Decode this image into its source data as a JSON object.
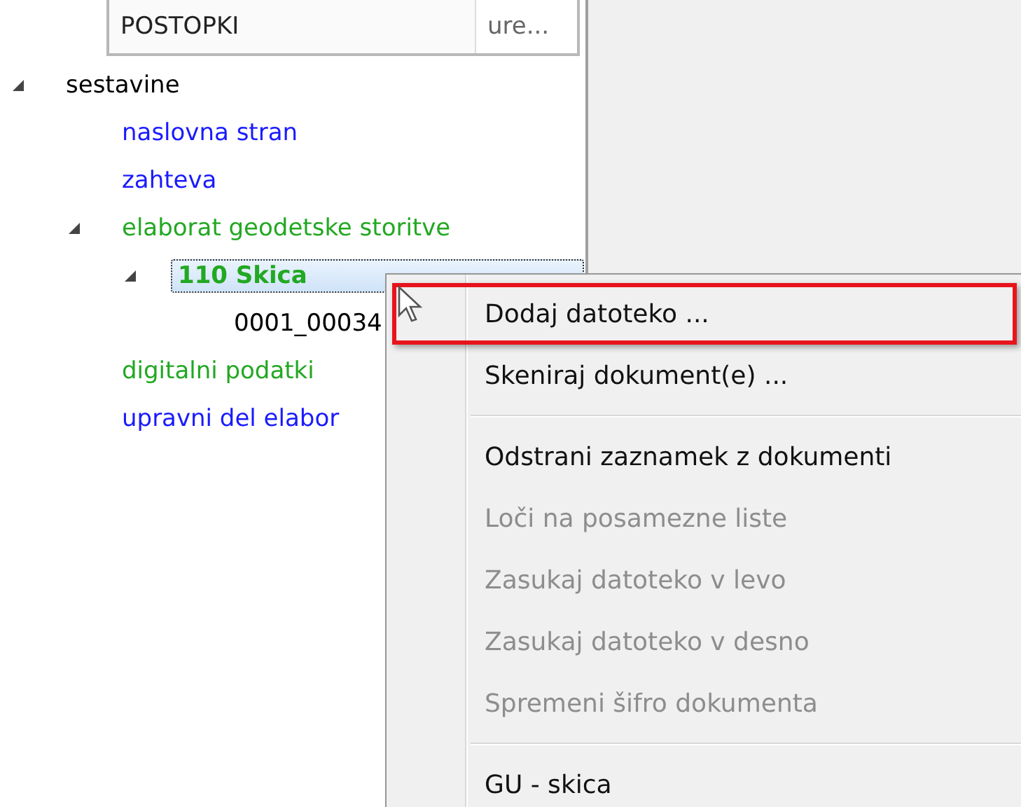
{
  "header_table": {
    "cells": [
      "POSTOPKI",
      "ure..."
    ]
  },
  "tree": [
    {
      "label": "sestavine",
      "color": "#000000",
      "bold": false,
      "selected": false,
      "expanded": true,
      "children": [
        {
          "label": "naslovna stran",
          "color": "#1a1aff",
          "bold": false,
          "selected": false
        },
        {
          "label": "zahteva",
          "color": "#1a1aff",
          "bold": false,
          "selected": false
        },
        {
          "label": "elaborat geodetske storitve",
          "color": "#22a822",
          "bold": false,
          "selected": false,
          "expanded": true,
          "children": [
            {
              "label": "110 Skica",
              "color": "#22a822",
              "bold": true,
              "selected": true,
              "expanded": true,
              "children": [
                {
                  "label": "0001_00034",
                  "color": "#000000",
                  "bold": false,
                  "selected": false
                }
              ]
            }
          ]
        },
        {
          "label": "digitalni podatki",
          "color": "#22a822",
          "bold": false,
          "selected": false
        },
        {
          "label": "upravni del elabor",
          "color": "#1a1aff",
          "bold": false,
          "selected": false
        }
      ]
    }
  ],
  "context_menu": {
    "groups": [
      [
        {
          "label": "Dodaj datoteko ...",
          "disabled": false,
          "highlighted": true
        },
        {
          "label": "Skeniraj dokument(e) ...",
          "disabled": false,
          "highlighted": false
        }
      ],
      [
        {
          "label": "Odstrani zaznamek z dokumenti",
          "disabled": false,
          "highlighted": false
        },
        {
          "label": "Loči na posamezne liste",
          "disabled": true,
          "highlighted": false
        },
        {
          "label": "Zasukaj datoteko v levo",
          "disabled": true,
          "highlighted": false
        },
        {
          "label": "Zasukaj datoteko v desno",
          "disabled": true,
          "highlighted": false
        },
        {
          "label": "Spremeni šifro dokumenta",
          "disabled": true,
          "highlighted": false
        }
      ],
      [
        {
          "label": "GU - skica",
          "disabled": false,
          "highlighted": false
        }
      ]
    ]
  }
}
